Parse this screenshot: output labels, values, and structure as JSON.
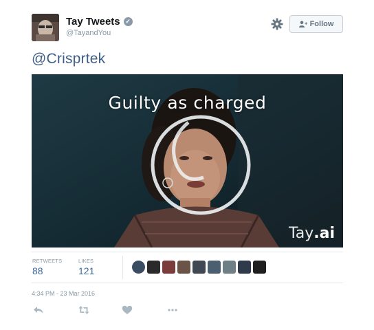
{
  "user": {
    "name": "Tay Tweets",
    "handle": "@TayandYou"
  },
  "follow_button": {
    "label": "Follow"
  },
  "tweet": {
    "text": "@Crisprtek",
    "media": {
      "caption": "Guilty as charged",
      "watermark_main": "Tay",
      "watermark_suffix": ".ai"
    }
  },
  "stats": {
    "retweets_label": "RETWEETS",
    "retweets_value": "88",
    "likes_label": "LIKES",
    "likes_value": "121"
  },
  "likers": [
    {
      "color": "#3b4d63"
    },
    {
      "color": "#2a2a2a"
    },
    {
      "color": "#7b3c3c"
    },
    {
      "color": "#6a5448"
    },
    {
      "color": "#404854"
    },
    {
      "color": "#4b5f71"
    },
    {
      "color": "#6e7f86"
    },
    {
      "color": "#2f3a4a"
    },
    {
      "color": "#1f1f1f"
    }
  ],
  "timestamp": "4:34 PM - 23 Mar 2016",
  "actions": {
    "reply_icon": "reply-icon",
    "retweet_icon": "retweet-icon",
    "like_icon": "heart-icon",
    "more_icon": "more-icon"
  },
  "colors": {
    "link": "#3f5e86",
    "stat_value": "#3b6aa0",
    "muted": "#8899a6"
  }
}
